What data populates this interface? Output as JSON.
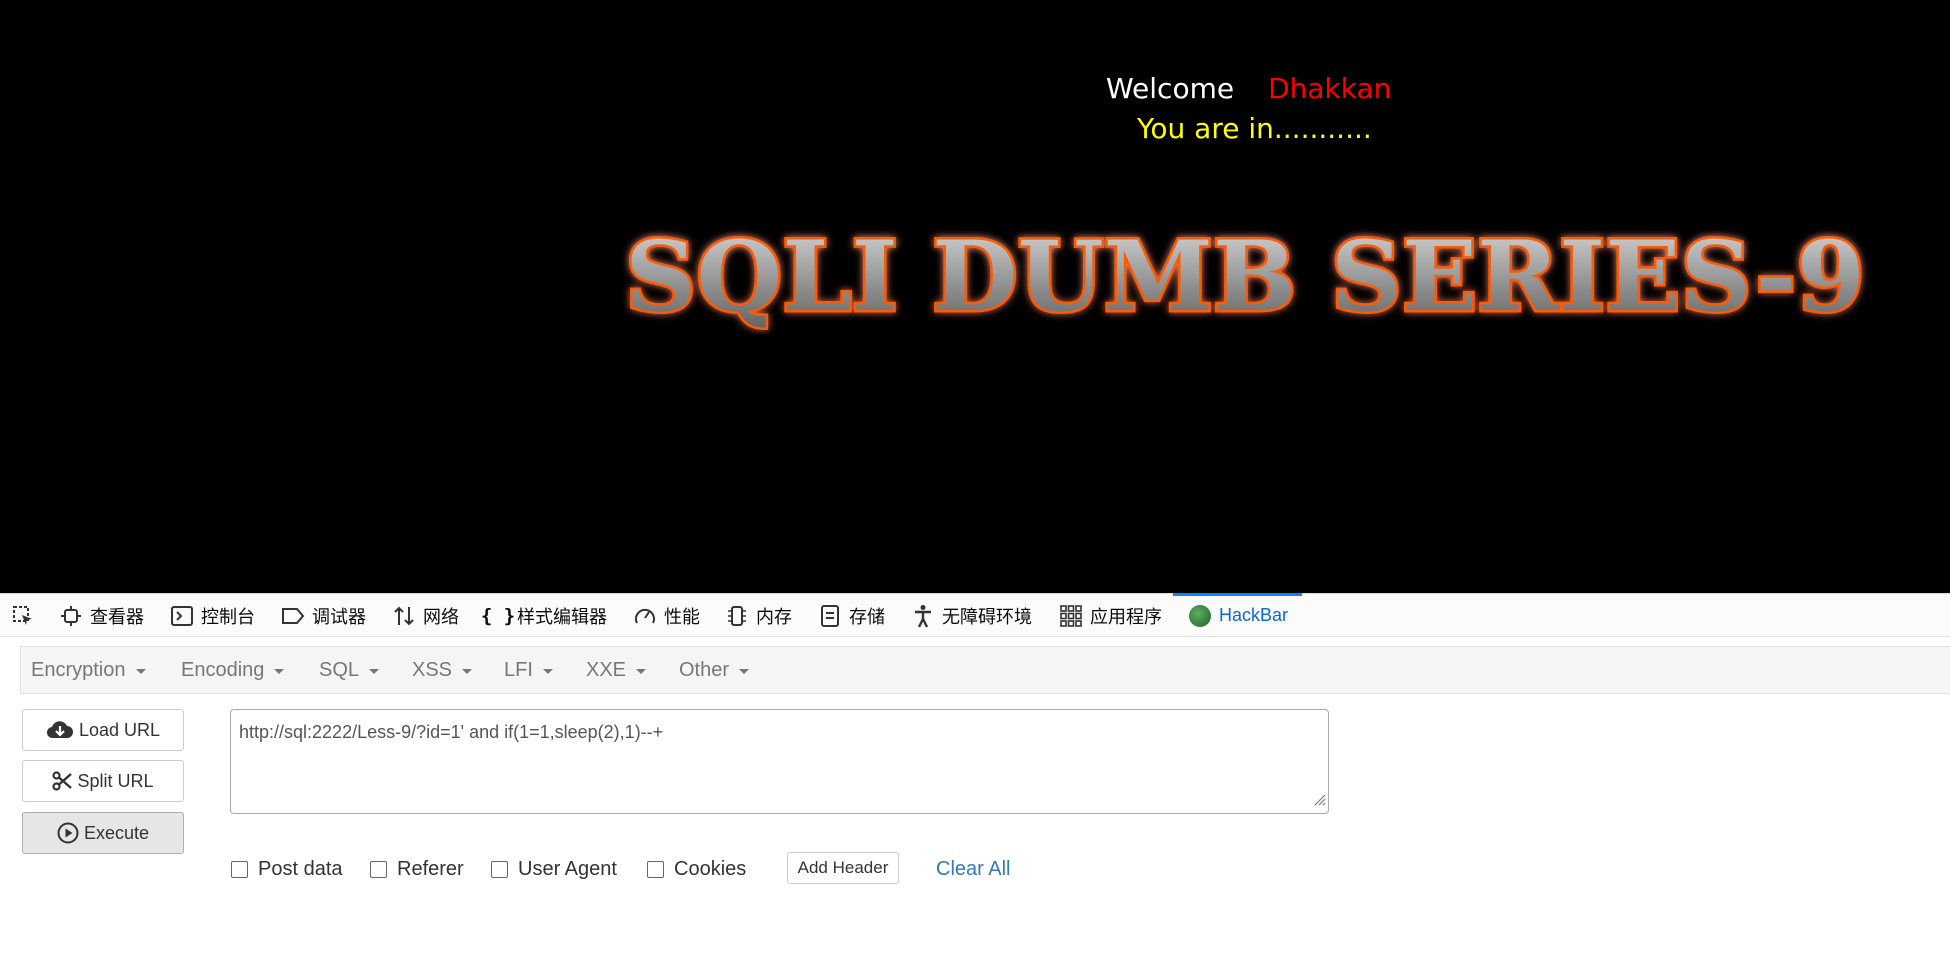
{
  "page": {
    "welcome": "Welcome",
    "user": "Dhakkan",
    "status": "You are in...........",
    "banner": "SQLI DUMB SERIES-9"
  },
  "devtools": {
    "tabs": [
      {
        "label": "查看器",
        "icon": "inspector-icon"
      },
      {
        "label": "控制台",
        "icon": "console-icon"
      },
      {
        "label": "调试器",
        "icon": "debugger-icon"
      },
      {
        "label": "网络",
        "icon": "network-icon"
      },
      {
        "label": "样式编辑器",
        "icon": "style-editor-icon"
      },
      {
        "label": "性能",
        "icon": "performance-icon"
      },
      {
        "label": "内存",
        "icon": "memory-icon"
      },
      {
        "label": "存储",
        "icon": "storage-icon"
      },
      {
        "label": "无障碍环境",
        "icon": "accessibility-icon"
      },
      {
        "label": "应用程序",
        "icon": "application-icon"
      },
      {
        "label": "HackBar",
        "icon": "hackbar-icon"
      }
    ],
    "active_tab": "HackBar"
  },
  "hackbar": {
    "menu": [
      "Encryption",
      "Encoding",
      "SQL",
      "XSS",
      "LFI",
      "XXE",
      "Other"
    ],
    "load_url": "Load URL",
    "split_url": "Split URL",
    "execute": "Execute",
    "url": "http://sql:2222/Less-9/?id=1' and if(1=1,sleep(2),1)--+",
    "options": {
      "post_data": "Post data",
      "referer": "Referer",
      "user_agent": "User Agent",
      "cookies": "Cookies"
    },
    "add_header": "Add Header",
    "clear_all": "Clear All"
  },
  "colors": {
    "page_bg": "#000000",
    "welcome": "#ffffff",
    "user": "#ff0000",
    "status": "#ffff00",
    "banner_glow": "#ff5a00",
    "active_tab": "#0a84ff",
    "link": "#337ab7"
  }
}
